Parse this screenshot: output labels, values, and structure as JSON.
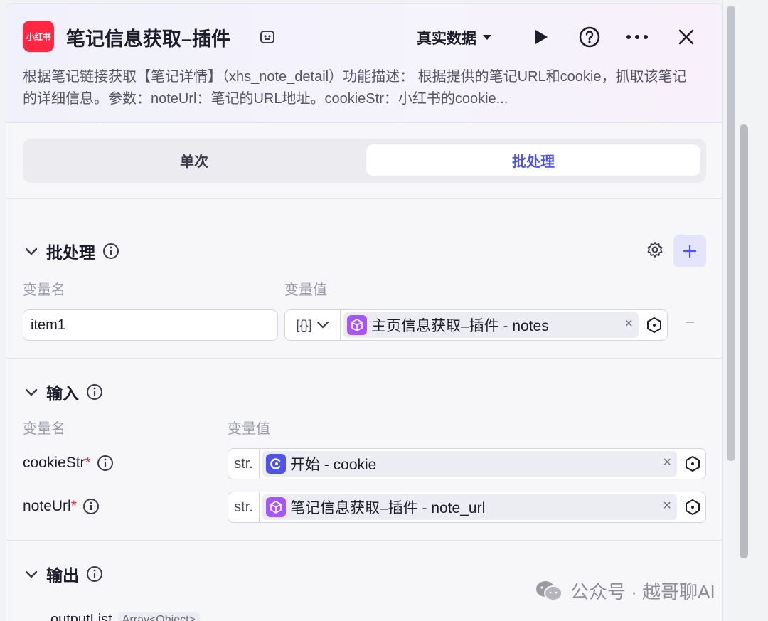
{
  "header": {
    "app_logo_text": "小红书",
    "title": "笔记信息获取–插件",
    "data_mode": "真实数据",
    "description": "根据笔记链接获取【笔记详情】（xhs_note_detail）功能描述： 根据提供的笔记URL和cookie，抓取该笔记的详细信息。参数：noteUrl：笔记的URL地址。cookieStr：小红书的cookie..."
  },
  "tabs": {
    "single": "单次",
    "batch": "批处理"
  },
  "batch_section": {
    "title": "批处理",
    "col_name": "变量名",
    "col_value": "变量值",
    "row": {
      "name": "item1",
      "type": "[{}]",
      "chip_label": "主页信息获取–插件 - notes"
    }
  },
  "input_section": {
    "title": "输入",
    "col_name": "变量名",
    "col_value": "变量值",
    "params": [
      {
        "name": "cookieStr",
        "required": "*",
        "type": "str.",
        "chip_label": "开始 - cookie"
      },
      {
        "name": "noteUrl",
        "required": "*",
        "type": "str.",
        "chip_label": "笔记信息获取–插件 - note_url"
      }
    ]
  },
  "output_section": {
    "title": "输出",
    "first_output_name": "outputList",
    "first_output_type": "Array<Object>"
  },
  "watermark": "公众号 · 越哥聊AI",
  "colors": {
    "accent": "#4d53e8",
    "brand_red": "#ff2742",
    "plugin_purple": "#a855f7",
    "start_blue": "#4d53e8",
    "required": "#e53241"
  }
}
